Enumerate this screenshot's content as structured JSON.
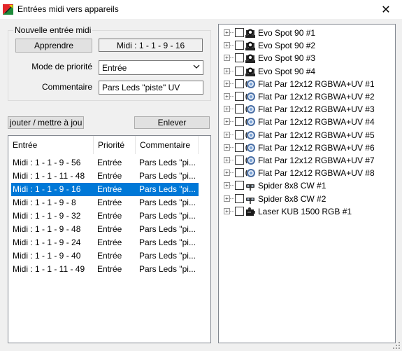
{
  "window": {
    "title": "Entrées midi vers appareils",
    "close_glyph": "✕"
  },
  "new_entry": {
    "group_title": "Nouvelle entrée midi",
    "learn_button": "Apprendre",
    "midi_value": "Midi : 1 - 1 - 9 - 16",
    "priority_label": "Mode de priorité",
    "priority_value": "Entrée",
    "comment_label": "Commentaire",
    "comment_value": "Pars Leds \"piste\" UV"
  },
  "buttons": {
    "add_update": "jouter / mettre à jou",
    "remove": "Enlever"
  },
  "list": {
    "columns": [
      "Entrée",
      "Priorité",
      "Commentaire"
    ],
    "rows": [
      {
        "entry": "Midi : 1 - 1 - 9 - 56",
        "priority": "Entrée",
        "comment": "Pars Leds \"pi...",
        "selected": false
      },
      {
        "entry": "Midi : 1 - 1 - 11 - 48",
        "priority": "Entrée",
        "comment": "Pars Leds \"pi...",
        "selected": false
      },
      {
        "entry": "Midi : 1 - 1 - 9 - 16",
        "priority": "Entrée",
        "comment": "Pars Leds \"pi...",
        "selected": true
      },
      {
        "entry": "Midi : 1 - 1 - 9 - 8",
        "priority": "Entrée",
        "comment": "Pars Leds \"pi...",
        "selected": false
      },
      {
        "entry": "Midi : 1 - 1 - 9 - 32",
        "priority": "Entrée",
        "comment": "Pars Leds \"pi...",
        "selected": false
      },
      {
        "entry": "Midi : 1 - 1 - 9 - 48",
        "priority": "Entrée",
        "comment": "Pars Leds \"pi...",
        "selected": false
      },
      {
        "entry": "Midi : 1 - 1 - 9 - 24",
        "priority": "Entrée",
        "comment": "Pars Leds \"pi...",
        "selected": false
      },
      {
        "entry": "Midi : 1 - 1 - 9 - 40",
        "priority": "Entrée",
        "comment": "Pars Leds \"pi...",
        "selected": false
      },
      {
        "entry": "Midi : 1 - 1 - 11 - 49",
        "priority": "Entrée",
        "comment": "Pars Leds \"pi...",
        "selected": false
      }
    ]
  },
  "devices": [
    {
      "label": "Evo Spot 90 #1",
      "icon": "moving-head-icon"
    },
    {
      "label": "Evo Spot 90 #2",
      "icon": "moving-head-icon"
    },
    {
      "label": "Evo Spot 90 #3",
      "icon": "moving-head-icon"
    },
    {
      "label": "Evo Spot 90 #4",
      "icon": "moving-head-icon"
    },
    {
      "label": "Flat Par 12x12 RGBWA+UV #1",
      "icon": "par-light-icon"
    },
    {
      "label": "Flat Par 12x12 RGBWA+UV #2",
      "icon": "par-light-icon"
    },
    {
      "label": "Flat Par 12x12 RGBWA+UV #3",
      "icon": "par-light-icon"
    },
    {
      "label": "Flat Par 12x12 RGBWA+UV #4",
      "icon": "par-light-icon"
    },
    {
      "label": "Flat Par 12x12 RGBWA+UV #5",
      "icon": "par-light-icon"
    },
    {
      "label": "Flat Par 12x12 RGBWA+UV #6",
      "icon": "par-light-icon"
    },
    {
      "label": "Flat Par 12x12 RGBWA+UV #7",
      "icon": "par-light-icon"
    },
    {
      "label": "Flat Par 12x12 RGBWA+UV #8",
      "icon": "par-light-icon"
    },
    {
      "label": "Spider 8x8 CW #1",
      "icon": "spider-light-icon"
    },
    {
      "label": "Spider 8x8 CW #2",
      "icon": "spider-light-icon"
    },
    {
      "label": "Laser KUB 1500 RGB #1",
      "icon": "laser-icon"
    }
  ],
  "colors": {
    "selection": "#0078d7",
    "button": "#e1e1e1",
    "window": "#f0f0f0"
  }
}
